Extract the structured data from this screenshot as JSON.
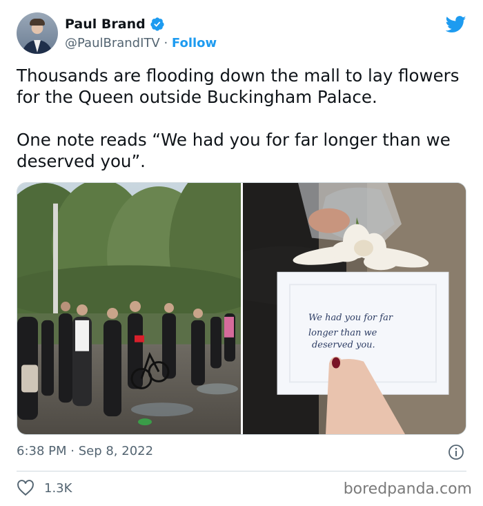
{
  "tweet": {
    "display_name": "Paul Brand",
    "handle": "@PaulBrandITV",
    "separator": " · ",
    "follow_label": "Follow",
    "text_paragraph_1": "Thousands are flooding down the mall to lay flowers for the Queen outside Buckingham Palace.",
    "text_paragraph_2": "One note reads “We had you for far longer than we deserved you”.",
    "time": "6:38 PM",
    "date": "Sep 8, 2022",
    "likes": "1.3K"
  },
  "photo_note": {
    "line1": "We had you for far",
    "line2": "longer than we",
    "line3": "deserved you."
  },
  "watermark": "boredpanda.com",
  "colors": {
    "accent": "#1d9bf0",
    "text": "#0f1419",
    "secondary": "#536471"
  },
  "icons": {
    "verified": "verified-badge-icon",
    "platform": "twitter-bird-icon",
    "info": "info-icon",
    "like": "heart-icon"
  }
}
